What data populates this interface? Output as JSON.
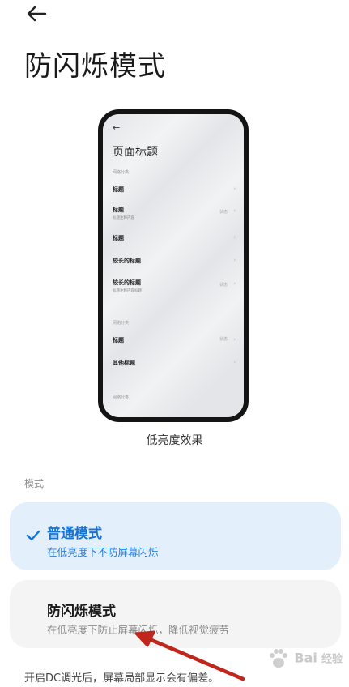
{
  "header": {
    "back_icon": "arrow-left-icon",
    "title": "防闪烁模式"
  },
  "preview": {
    "back_icon": "arrow-left-icon",
    "page_title": "页面标题",
    "section1": "网络分类",
    "rows": [
      {
        "title": "标题",
        "subtitle": "",
        "right": ""
      },
      {
        "title": "标题",
        "subtitle": "标题注释内容",
        "right": "状态"
      },
      {
        "title": "标题",
        "subtitle": "",
        "right": ""
      },
      {
        "title": "较长的标题",
        "subtitle": "",
        "right": ""
      },
      {
        "title": "较长的标题",
        "subtitle": "标题注释内容标题",
        "right": "状态"
      }
    ],
    "section2": "网络分类",
    "rows2": [
      {
        "title": "标题",
        "right": "状态"
      },
      {
        "title": "其他标题",
        "right": ""
      }
    ],
    "section3": "网络分类",
    "caption": "低亮度效果"
  },
  "modes": {
    "section_label": "模式",
    "options": [
      {
        "title": "普通模式",
        "desc": "在低亮度下不防屏幕闪烁",
        "selected": true
      },
      {
        "title": "防闪烁模式",
        "desc": "在低亮度下防止屏幕闪烁，降低视觉疲劳",
        "selected": false
      }
    ],
    "check_icon": "checkmark-icon"
  },
  "footer": {
    "note": "开启DC调光后，屏幕局部显示会有偏差。"
  },
  "annotation": {
    "arrow_icon": "red-arrow-icon",
    "arrow_color": "#c0261c"
  },
  "watermark": {
    "text": "Bai",
    "text2": "经验",
    "icon": "paw-icon"
  },
  "colors": {
    "accent": "#1673d6",
    "selected_bg": "#e3effb",
    "card_bg": "#f4f4f5"
  }
}
